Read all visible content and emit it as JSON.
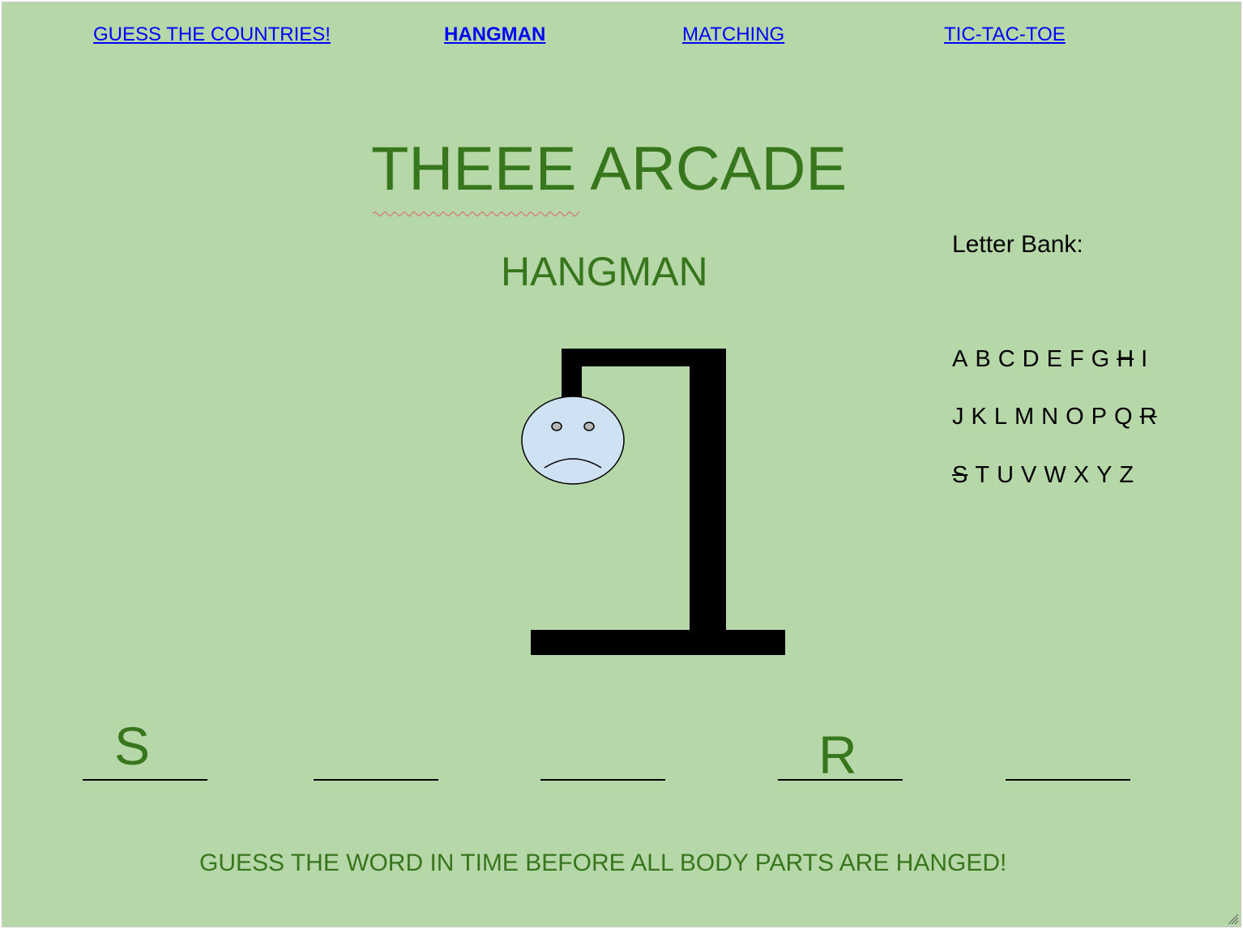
{
  "nav": {
    "links": [
      {
        "label": "GUESS THE COUNTRIES!"
      },
      {
        "label": "HANGMAN"
      },
      {
        "label": "MATCHING"
      },
      {
        "label": "TIC-TAC-TOE"
      }
    ]
  },
  "header": {
    "title_word1": "THEEE",
    "title_word2": "ARCADE",
    "subtitle": "HANGMAN"
  },
  "letter_bank": {
    "label": "Letter Bank:",
    "rows": [
      [
        "A",
        "B",
        "C",
        "D",
        "E",
        "F",
        "G",
        "H",
        "I"
      ],
      [
        "J",
        "K",
        "L",
        "M",
        "N",
        "O",
        "P",
        "Q",
        "R"
      ],
      [
        "S",
        "T",
        "U",
        "V",
        "W",
        "X",
        "Y",
        "Z"
      ]
    ],
    "used": [
      "H",
      "R",
      "S"
    ]
  },
  "word": {
    "slots": [
      "S",
      "",
      "",
      "R",
      ""
    ]
  },
  "hangman": {
    "parts_shown": [
      "head"
    ],
    "mood": "sad"
  },
  "instructions": "GUESS THE WORD IN TIME BEFORE ALL BODY PARTS ARE HANGED!",
  "colors": {
    "background": "#b6d7a8",
    "accent_text": "#38761d",
    "link": "#0000ff",
    "head_fill": "#cfe2f3"
  }
}
